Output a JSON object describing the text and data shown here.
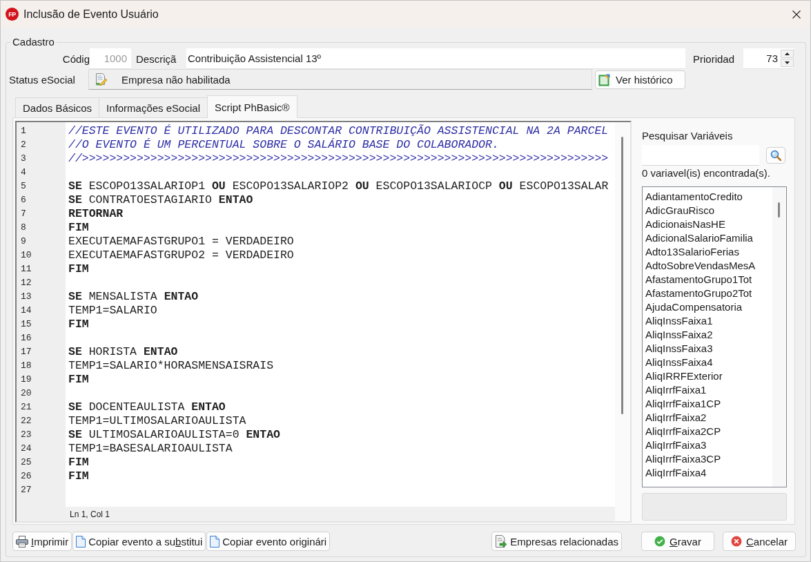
{
  "window": {
    "app_badge": "FP",
    "title": "Inclusão de Evento Usuário"
  },
  "group": {
    "title": "Cadastro"
  },
  "fields": {
    "code": {
      "label": "Códig",
      "value": "1000",
      "disabled": true
    },
    "description": {
      "label": "Descriçã",
      "value": "Contribuição Assistencial 13º"
    },
    "priority": {
      "label": "Prioridad",
      "value": "73"
    },
    "esocial_status": {
      "label": "Status eSocial",
      "value": "Empresa não habilitada"
    }
  },
  "history_button": {
    "label": "Ver histórico"
  },
  "tabs": [
    {
      "label": "Dados Básicos",
      "selected": false
    },
    {
      "label": "Informações eSocial",
      "selected": false
    },
    {
      "label": "Script PhBasic®",
      "selected": true
    }
  ],
  "editor": {
    "lines": [
      {
        "number": "1",
        "kind": "comment",
        "text": "//ESTE EVENTO É UTILIZADO PARA DESCONTAR CONTRIBUIÇÃO ASSISTENCIAL NA 2A PARCEL"
      },
      {
        "number": "2",
        "kind": "comment",
        "text": "//O EVENTO É UM PERCENTUAL SOBRE O SALÁRIO BASE DO COLABORADOR."
      },
      {
        "number": "3",
        "kind": "comment",
        "text": "//>>>>>>>>>>>>>>>>>>>>>>>>>>>>>>>>>>>>>>>>>>>>>>>>>>>>>>>>>>>>>>>>>>>>>>>>>>>>>"
      },
      {
        "number": "4",
        "kind": "blank"
      },
      {
        "number": "5",
        "kind": "code",
        "text": "**SE** ESCOPO13SALARIOP1 **OU** ESCOPO13SALARIOP2 **OU** ESCOPO13SALARIOCP **OU** ESCOPO13SALAR"
      },
      {
        "number": "6",
        "kind": "code",
        "text": "**SE** CONTRATOESTAGIARIO **ENTAO**"
      },
      {
        "number": "7",
        "kind": "keyword",
        "text": "RETORNAR"
      },
      {
        "number": "8",
        "kind": "keyword",
        "text": "FIM"
      },
      {
        "number": "9",
        "kind": "plain",
        "text": "EXECUTAEMAFASTGRUPO1 = VERDADEIRO"
      },
      {
        "number": "10",
        "kind": "plain",
        "text": "EXECUTAEMAFASTGRUPO2 = VERDADEIRO"
      },
      {
        "number": "11",
        "kind": "keyword",
        "text": "FIM"
      },
      {
        "number": "12",
        "kind": "blank"
      },
      {
        "number": "13",
        "kind": "code",
        "text": "**SE** MENSALISTA **ENTAO**"
      },
      {
        "number": "14",
        "kind": "plain",
        "text": "TEMP1=SALARIO"
      },
      {
        "number": "15",
        "kind": "keyword",
        "text": "FIM"
      },
      {
        "number": "16",
        "kind": "blank"
      },
      {
        "number": "17",
        "kind": "code",
        "text": "**SE** HORISTA **ENTAO**"
      },
      {
        "number": "18",
        "kind": "plain",
        "text": "TEMP1=SALARIO*HORASMENSAISRAIS"
      },
      {
        "number": "19",
        "kind": "keyword",
        "text": "FIM"
      },
      {
        "number": "20",
        "kind": "blank"
      },
      {
        "number": "21",
        "kind": "code",
        "text": "**SE** DOCENTEAULISTA **ENTAO**"
      },
      {
        "number": "22",
        "kind": "plain",
        "text": "TEMP1=ULTIMOSALARIOAULISTA"
      },
      {
        "number": "23",
        "kind": "code",
        "text": "**SE** ULTIMOSALARIOAULISTA=0 **ENTAO**"
      },
      {
        "number": "24",
        "kind": "plain",
        "text": "TEMP1=BASESALARIOAULISTA"
      },
      {
        "number": "25",
        "kind": "keyword",
        "text": "FIM"
      },
      {
        "number": "26",
        "kind": "keyword",
        "text": "FIM"
      },
      {
        "number": "27",
        "kind": "blank"
      }
    ],
    "status": "Ln 1, Col 1"
  },
  "variables": {
    "search_label": "Pesquisar Variáveis",
    "result_count": "0 variavel(is) encontrada(s).",
    "items": [
      "AdiantamentoCredito",
      "AdicGrauRisco",
      "AdicionaisNasHE",
      "AdicionalSalarioFamilia",
      "Adto13SalarioFerias",
      "AdtoSobreVendasMesA",
      "AfastamentoGrupo1Tot",
      "AfastamentoGrupo2Tot",
      "AjudaCompensatoria",
      "AliqInssFaixa1",
      "AliqInssFaixa2",
      "AliqInssFaixa3",
      "AliqInssFaixa4",
      "AliqIRRFExterior",
      "AliqIrrfFaixa1",
      "AliqIrrfFaixa1CP",
      "AliqIrrfFaixa2",
      "AliqIrrfFaixa2CP",
      "AliqIrrfFaixa3",
      "AliqIrrfFaixa3CP",
      "AliqIrrfFaixa4"
    ]
  },
  "bottom_bar": {
    "left": [
      {
        "kind": "print",
        "label": {
          "key": "I",
          "after": "mprimir"
        }
      },
      {
        "kind": "copy",
        "label": {
          "before": "Copiar evento a su",
          "key": "b",
          "after": "stitui"
        }
      },
      {
        "kind": "copy",
        "label": "Copiar evento originári"
      }
    ],
    "right": [
      {
        "kind": "related",
        "label": "Empresas relacionadas"
      },
      {
        "kind": "save",
        "label": {
          "key": "G",
          "after": "ravar"
        }
      },
      {
        "kind": "cancel",
        "label": {
          "key": "C",
          "after": "ancelar"
        }
      }
    ]
  }
}
